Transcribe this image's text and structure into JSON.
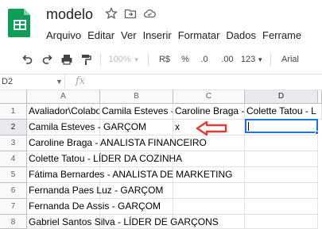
{
  "doc": {
    "title": "modelo"
  },
  "menu": {
    "items": [
      "Arquivo",
      "Editar",
      "Ver",
      "Inserir",
      "Formatar",
      "Dados",
      "Ferrame"
    ]
  },
  "toolbar": {
    "zoom": "100%",
    "currency": "R$",
    "percent": "%",
    "decrease_decimals": ".0",
    "increase_decimals": ".00",
    "number_format": "123",
    "font": "Arial"
  },
  "formula_bar": {
    "name_box": "D2",
    "fx": "fx",
    "value": ""
  },
  "grid": {
    "columns": [
      "A",
      "B",
      "C",
      "D"
    ],
    "rows": [
      "1",
      "2",
      "3",
      "4",
      "5",
      "6",
      "7",
      "8"
    ],
    "header_row": [
      "Avaliador\\Colabo",
      "Camila Esteves - ",
      "Caroline Braga - ",
      "Colette Tatou - L"
    ],
    "row_values": [
      "Camila Esteves - GARÇOM",
      "Caroline Braga - ANALISTA FINANCEIRO",
      "Colette Tatou - LÍDER DA COZINHA",
      "Fátima Bernardes - ANALISTA DE MARKETING",
      "Fernanda Paes Luz - GARÇOM",
      "Fernanda De Assis - GARÇOM",
      "Gabriel Santos Silva - LÍDER DE GARÇONS"
    ],
    "c2": "x",
    "selected_cell": "D2"
  },
  "colors": {
    "accent": "#1a73e8",
    "annotation_arrow": "#e53935",
    "sheets_green": "#0f9d58"
  }
}
